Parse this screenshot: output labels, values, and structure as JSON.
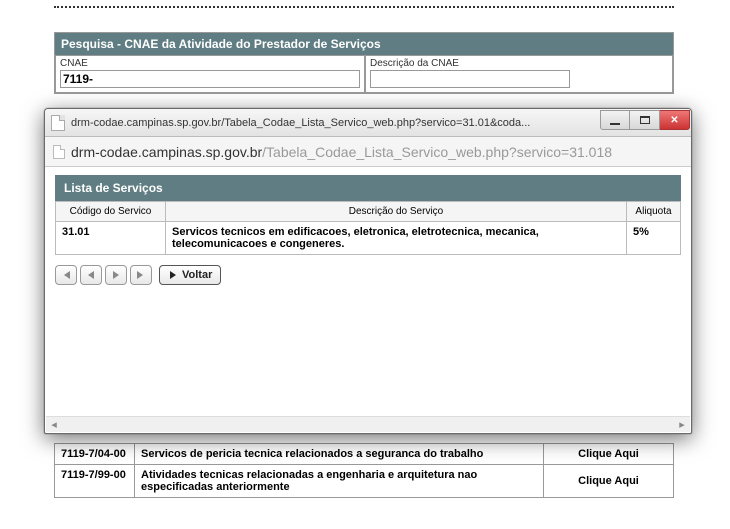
{
  "search": {
    "title": "Pesquisa - CNAE da Atividade do Prestador de Serviços",
    "cnae_label": "CNAE",
    "cnae_value": "7119-",
    "desc_label": "Descrição da CNAE",
    "desc_value": ""
  },
  "bg_rows": [
    {
      "code": "7119-7/04-00",
      "desc": "Servicos de pericia tecnica relacionados a seguranca do trabalho",
      "action": "Clique Aqui"
    },
    {
      "code": "7119-7/99-00",
      "desc": "Atividades tecnicas relacionadas a engenharia e arquitetura nao especificadas anteriormente",
      "action": "Clique Aqui"
    }
  ],
  "popup": {
    "titlebar": "drm-codae.campinas.sp.gov.br/Tabela_Codae_Lista_Servico_web.php?servico=31.01&coda...",
    "addr_host": "drm-codae.campinas.sp.gov.br",
    "addr_path": "/Tabela_Codae_Lista_Servico_web.php?servico=31.018",
    "list_title": "Lista de Serviços",
    "columns": {
      "code": "Código do Servico",
      "desc": "Descrição do Serviço",
      "aliq": "Aliquota"
    },
    "rows": [
      {
        "code": "31.01",
        "desc": "Servicos tecnicos em edificacoes, eletronica, eletrotecnica, mecanica, telecomunicacoes e congeneres.",
        "aliq": "5%"
      }
    ],
    "voltar": "Voltar"
  }
}
